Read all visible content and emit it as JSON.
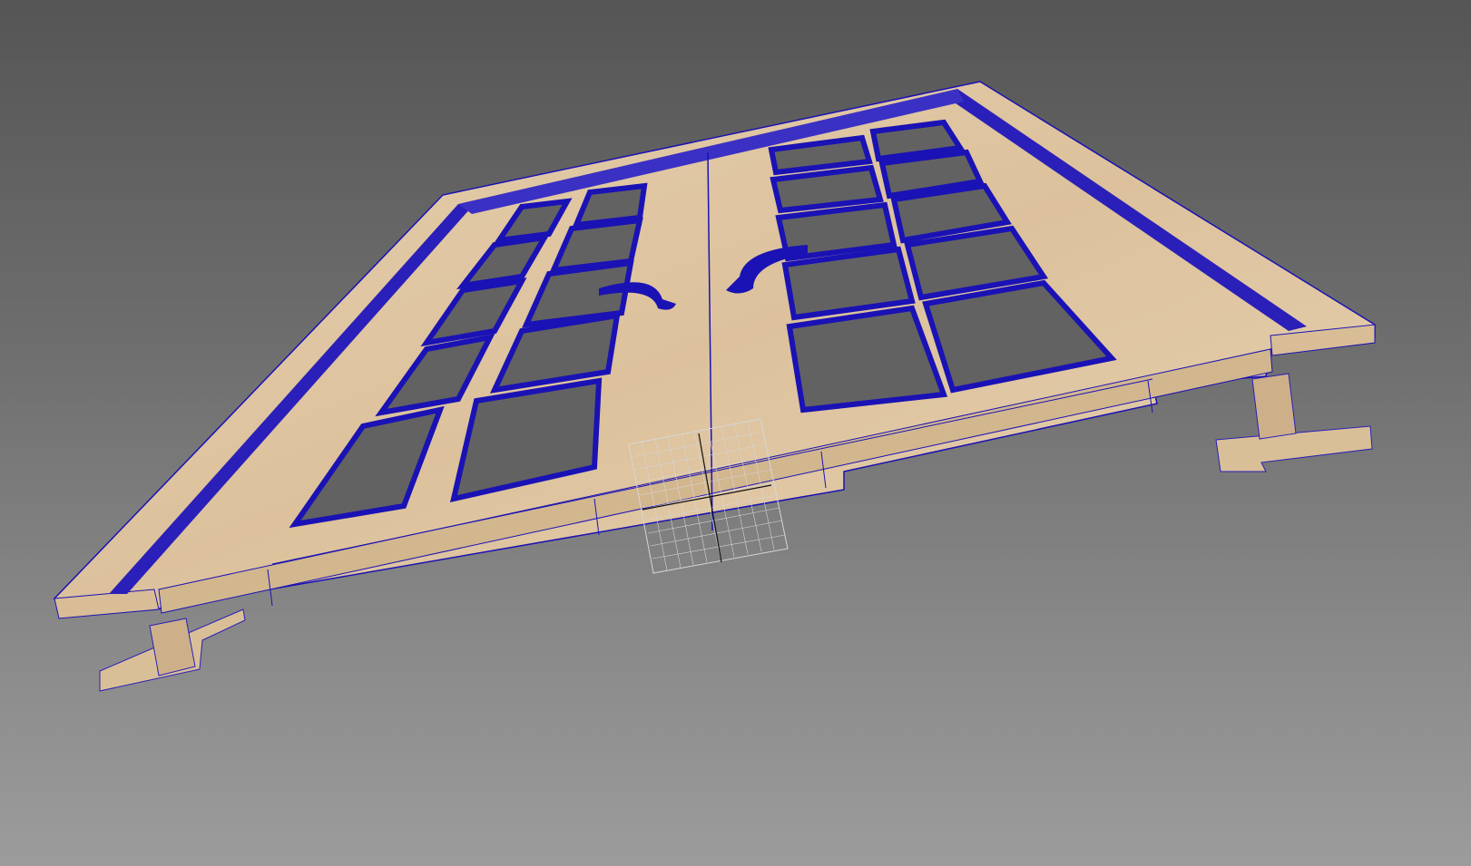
{
  "viewport": {
    "mode": "3d-perspective",
    "shading": "textured-with-wireframe",
    "background_top": "#555555",
    "background_bottom": "#9c9c9c"
  },
  "model": {
    "object": "double-door-with-frame",
    "orientation": "lying-flat",
    "wood_color": "#e2c7a0",
    "wood_shade": "#c9ab83",
    "wire_color": "#1a12b4",
    "glass_color": "#626262",
    "grid_color": "#d6d6d6",
    "left_leaf_panes": {
      "rows": 5,
      "cols": 2
    },
    "right_leaf_panes": {
      "rows": 5,
      "cols": 2
    },
    "handles": [
      "left-handle",
      "right-handle"
    ]
  }
}
